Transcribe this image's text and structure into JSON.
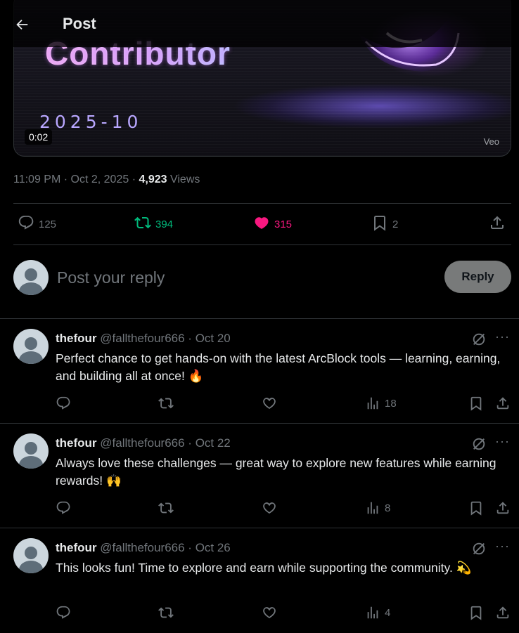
{
  "header": {
    "title": "Post"
  },
  "media": {
    "headline": "Contributor",
    "date": "2025-10",
    "duration": "0:02",
    "watermark": "Veo"
  },
  "post_meta": {
    "time": "11:09 PM",
    "date": "Oct 2, 2025",
    "views": "4,923",
    "views_label": "Views"
  },
  "actions": {
    "replies": "125",
    "reposts": "394",
    "likes": "315",
    "bookmarks": "2"
  },
  "composer": {
    "placeholder": "Post your reply",
    "button": "Reply"
  },
  "colors": {
    "repost": "#00ba7c",
    "like": "#f91880",
    "muted": "#71767b"
  },
  "replies": [
    {
      "name": "thefour",
      "handle": "@fallthefour666",
      "date": "Oct 20",
      "text": "Perfect chance to get hands-on with the latest ArcBlock tools — learning, earning, and building all at once! 🔥",
      "views": "18"
    },
    {
      "name": "thefour",
      "handle": "@fallthefour666",
      "date": "Oct 22",
      "text": "Always love these challenges — great way to explore new features while earning rewards! 🙌",
      "views": "8"
    },
    {
      "name": "thefour",
      "handle": "@fallthefour666",
      "date": "Oct 26",
      "text": "This looks fun! Time to explore and earn while supporting the community. 💫",
      "views": "4"
    }
  ]
}
